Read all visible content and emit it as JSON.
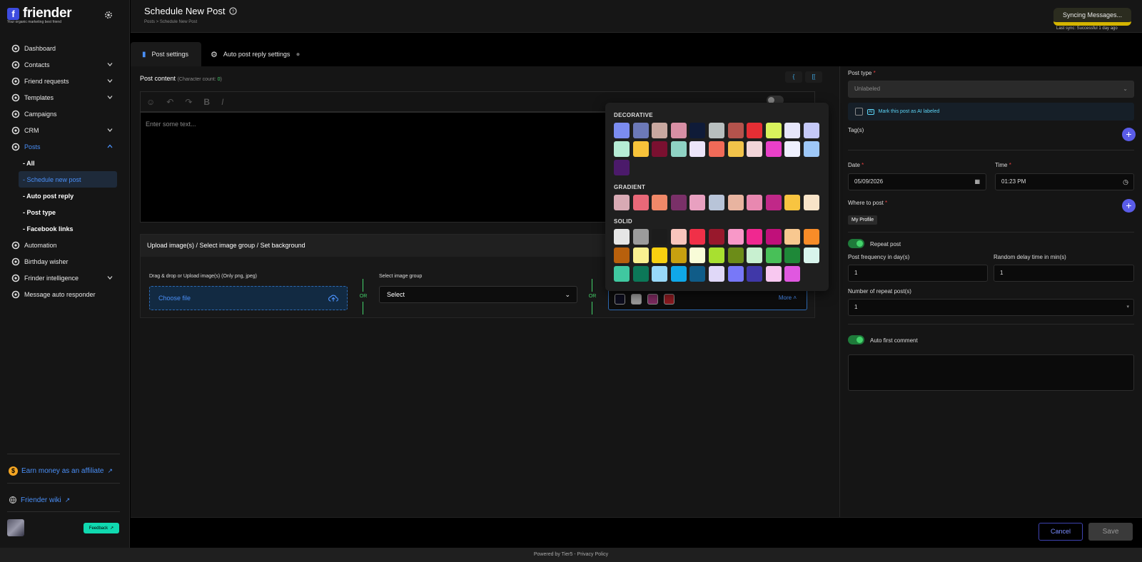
{
  "app": {
    "logo_letter": "f",
    "name": "friender",
    "tagline": "Your organic marketing best friend"
  },
  "sidebar": {
    "items": [
      {
        "label": "Dashboard",
        "icon": "dashboard-icon"
      },
      {
        "label": "Contacts",
        "icon": "contacts-icon",
        "expandable": true
      },
      {
        "label": "Friend requests",
        "icon": "friend-requests-icon",
        "expandable": true
      },
      {
        "label": "Templates",
        "icon": "templates-icon",
        "expandable": true
      },
      {
        "label": "Campaigns",
        "icon": "megaphone-icon"
      },
      {
        "label": "CRM",
        "icon": "crm-icon",
        "expandable": true
      },
      {
        "label": "Posts",
        "icon": "posts-icon",
        "expandable": true,
        "active": true
      }
    ],
    "post_subitems": [
      {
        "label": "- All"
      },
      {
        "label": "- Schedule new post",
        "active": true
      },
      {
        "label": "- Auto post reply"
      },
      {
        "label": "- Post type"
      },
      {
        "label": "- Facebook links"
      }
    ],
    "items_after": [
      {
        "label": "Automation",
        "icon": "lightning-icon"
      },
      {
        "label": "Birthday wisher",
        "icon": "cake-icon"
      },
      {
        "label": "Frinder intelligence",
        "icon": "intelligence-icon",
        "expandable": true
      },
      {
        "label": "Message auto responder",
        "icon": "message-icon"
      }
    ],
    "affiliate": "Earn money as an affiliate",
    "affiliate_coin": "$",
    "wiki": "Friender wiki",
    "feedback": "Feedback"
  },
  "header": {
    "title": "Schedule New Post",
    "breadcrumb": "Posts  >  Schedule New Post",
    "sync_button": "Syncing Messages...",
    "last_sync": "Last sync: Successful 1 day ago"
  },
  "tabs": [
    {
      "label": "Post settings",
      "active": true
    },
    {
      "label": "Auto post reply settings"
    }
  ],
  "editor": {
    "label": "Post content",
    "char_count_prefix": "(Character count: ",
    "char_count": "0",
    "char_count_suffix": ")",
    "placeholder": "Enter some text...",
    "code_btn_1": "{",
    "code_btn_2": "[["
  },
  "upload": {
    "heading": "Upload image(s) / Select image group / Set background",
    "drag_label": "Drag & drop or Upload image(s) (Only png, jpeg)",
    "choose_file": "Choose file",
    "or": "OR",
    "group_label": "Select image group",
    "group_value": "Select",
    "more": "More",
    "bg_swatches": [
      "#0d0d1e",
      "#9a9a9a",
      "#7b2a5e",
      "#8a1a20"
    ]
  },
  "palette": {
    "decorative_title": "DECORATIVE",
    "decorative": [
      "#7b8cf0",
      "#6c79b8",
      "#c9a8a0",
      "#d88fa4",
      "#0f1b38",
      "#b8bfbf",
      "#b4534c",
      "#e52e34",
      "#d8f25c",
      "#e6e6fa",
      "#c5c9f8",
      "#b6ecd6",
      "#f8c23a",
      "#7a1030",
      "#8fd2c4",
      "#ece4f8",
      "#f06a58",
      "#f2c34a",
      "#f2d4d8",
      "#e940c8",
      "#eef0fe",
      "#9ec8f8",
      "#4b1a6a"
    ],
    "gradient_title": "GRADIENT",
    "gradient": [
      "#d8aab4",
      "#e86878",
      "#f08868",
      "#7a3068",
      "#e8a0c0",
      "#b8c4d8",
      "#e8b4a0",
      "#e888b0",
      "#c02888",
      "#f8c440",
      "#f8e4c8"
    ],
    "solid_title": "SOLID",
    "solid": [
      "#e6e6e6",
      "#9c9c9c",
      "#1c1c1c",
      "#f8c4bc",
      "#f03048",
      "#98182c",
      "#f898c8",
      "#f02890",
      "#c0107a",
      "#f8c890",
      "#f88c28",
      "#b8600c",
      "#f8f090",
      "#f8d010",
      "#c8a010",
      "#f8fcd8",
      "#a8e030",
      "#6c8c18",
      "#c8f0d0",
      "#48c058",
      "#1e8838",
      "#d8f4ec",
      "#40c8a0",
      "#0c7858",
      "#98d8f8",
      "#10a8e8",
      "#105c88",
      "#e0d8f8",
      "#7878f8",
      "#4038a8",
      "#f8c8f0",
      "#e058e0"
    ]
  },
  "right": {
    "post_type_label": "Post type",
    "post_type_value": "Unlabeled",
    "ai_label": "Mark this post as AI labeled",
    "tags_label": "Tag(s)",
    "plus": "+",
    "date_label": "Date",
    "date_value": "05/09/2026",
    "time_label": "Time",
    "time_value": "01:23  PM",
    "where_label": "Where to post",
    "where_chip": "My Profile",
    "repeat_label": "Repeat post",
    "freq_label": "Post frequency in day(s)",
    "freq_value": "1",
    "delay_label": "Random delay time in min(s)",
    "delay_value": "1",
    "num_label": "Number of repeat post(s)",
    "num_value": "1",
    "auto_comment_label": "Auto first comment",
    "required": "*"
  },
  "actions": {
    "cancel": "Cancel",
    "save": "Save"
  },
  "footer": "Powered by Tier5 - Privacy Policy"
}
